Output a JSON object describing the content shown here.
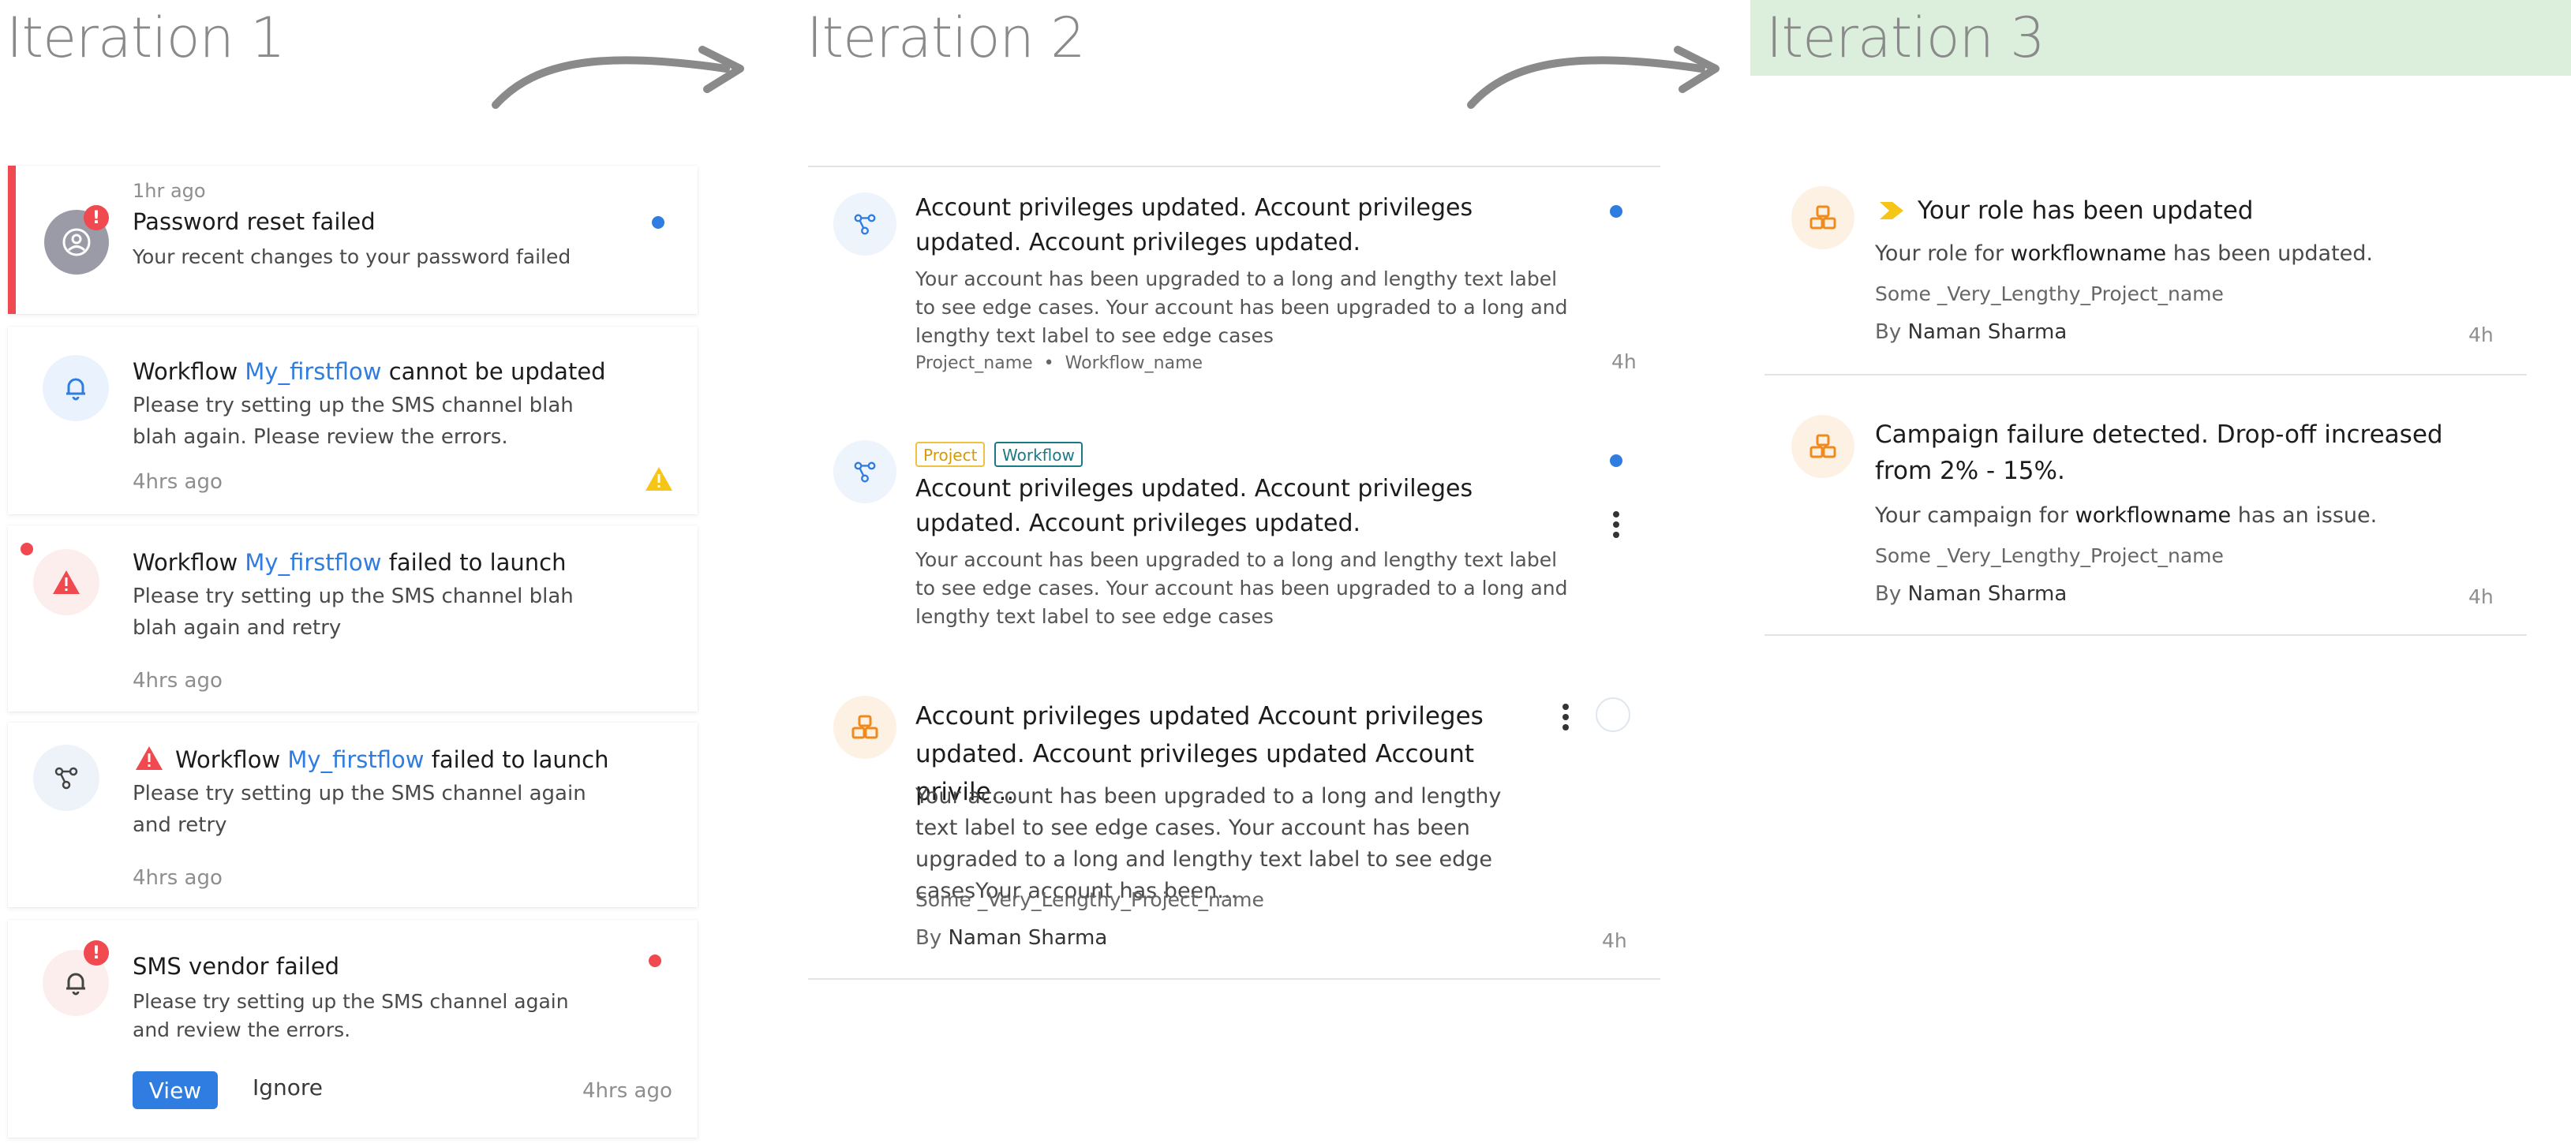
{
  "iterations": {
    "iter1": "Iteration 1",
    "iter2": "Iteration 2",
    "iter3": "Iteration 3"
  },
  "colors": {
    "accent": "#2f7de1",
    "error": "#f0494f",
    "warning": "#f5c518",
    "highlight_band": "#dcefdc"
  },
  "col1": {
    "card1": {
      "time": "1hr ago",
      "title": "Password reset failed",
      "body": "Your recent changes to your password failed",
      "icon": "user-icon"
    },
    "card2": {
      "title_pre": "Workflow ",
      "link": "My_firstflow",
      "title_post": " cannot be updated",
      "body": "Please try setting up the SMS channel blah blah again. Please review the errors.",
      "time": "4hrs ago",
      "icon": "bell-icon"
    },
    "card3": {
      "title_pre": "Workflow ",
      "link": "My_firstflow",
      "title_post": " failed to launch",
      "body": "Please try setting up the SMS channel blah blah again and retry",
      "time": "4hrs ago",
      "icon": "warning-icon"
    },
    "card4": {
      "title_pre": "Workflow ",
      "link": "My_firstflow",
      "title_post": " failed to launch",
      "body": "Please try setting up the SMS channel again and retry",
      "time": "4hrs ago",
      "icon": "workflow-icon"
    },
    "card5": {
      "title": "SMS vendor failed",
      "body": "Please try setting up the SMS channel again and review the errors.",
      "view": "View",
      "ignore": "Ignore",
      "time": "4hrs ago",
      "icon": "bell-icon"
    }
  },
  "col2": {
    "item1": {
      "title": "Account privileges updated. Account privileges updated. Account privileges updated.",
      "body": "Your account has been upgraded to a long and lengthy text label to see edge cases. Your account has been upgraded to a long and lengthy text label to see edge cases",
      "project": "Project_name",
      "sep": "•",
      "workflow": "Workflow_name",
      "time": "4h"
    },
    "item2": {
      "tag_project": "Project",
      "tag_workflow": "Workflow",
      "title": "Account privileges updated. Account privileges updated. Account privileges updated.",
      "body": "Your account has been upgraded to a long and lengthy text label to see edge cases. Your account has been upgraded to a long and lengthy text label to see edge cases"
    },
    "item3": {
      "title": "Account privileges updated Account privileges updated. Account privileges updated Account privile...",
      "body": "Your account has been upgraded to a long and lengthy text label to see edge cases. Your account has been upgraded to a long and lengthy text label to see edge casesYour account has been...",
      "project": "Some _Very_Lengthy_Project_name",
      "by": "By ",
      "author": "Naman Sharma",
      "time": "4h"
    }
  },
  "col3": {
    "item1": {
      "title": "Your role has been updated",
      "body_pre": "Your role for ",
      "body_bold": "workflowname",
      "body_post": " has been updated.",
      "project": "Some _Very_Lengthy_Project_name",
      "by": "By ",
      "author": "Naman Sharma",
      "time": "4h"
    },
    "item2": {
      "title": "Campaign failure detected. Drop-off increased from 2% - 15%.",
      "body_pre": "Your campaign for ",
      "body_bold": "workflowname",
      "body_post": " has an issue.",
      "project": "Some _Very_Lengthy_Project_name",
      "by": "By ",
      "author": "Naman Sharma",
      "time": "4h"
    }
  }
}
